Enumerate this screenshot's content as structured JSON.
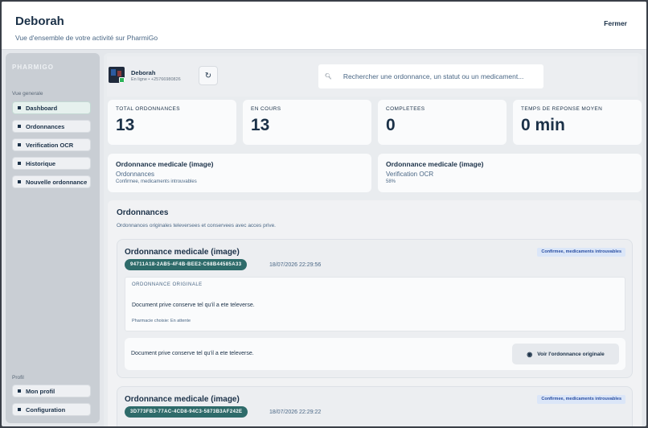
{
  "header": {
    "title": "Deborah",
    "subtitle": "Vue d'ensemble de votre activité sur PharmiGo",
    "close_label": "Fermer"
  },
  "sidebar": {
    "brand": "PHARMIGO",
    "section_overview": "Vue generale",
    "items": [
      {
        "label": "Dashboard",
        "active": true
      },
      {
        "label": "Ordonnances"
      },
      {
        "label": "Verification OCR"
      },
      {
        "label": "Historique"
      },
      {
        "label": "Nouvelle ordonnance"
      }
    ],
    "section_profile": "Profil",
    "profile_items": [
      {
        "label": "Mon profil"
      },
      {
        "label": "Configuration"
      }
    ]
  },
  "user": {
    "name": "Deborah",
    "status": "En ligne • +25766980826"
  },
  "search": {
    "placeholder": "Rechercher une ordonnance, un statut ou un medicament..."
  },
  "stats": [
    {
      "label": "TOTAL ORDONNANCES",
      "value": "13"
    },
    {
      "label": "EN COURS",
      "value": "13"
    },
    {
      "label": "COMPLETEES",
      "value": "0"
    },
    {
      "label": "TEMPS DE REPONSE MOYEN",
      "value": "0 min"
    }
  ],
  "info_cards": [
    {
      "title": "Ordonnance medicale (image)",
      "subtitle": "Ordonnances",
      "detail": "Confirmee, medicaments introuvables"
    },
    {
      "title": "Ordonnance medicale (image)",
      "subtitle": "Verification OCR",
      "detail": "58%"
    }
  ],
  "list": {
    "title": "Ordonnances",
    "subtitle": "Ordonnances originales televersees et conservees avec acces prive.",
    "items": [
      {
        "title": "Ordonnance medicale (image)",
        "badge": "Confirmee, medicaments introuvables",
        "id": "94711A18-2AB5-4F4B-BEE2-C68B44585A33",
        "date": "18/07/2026 22:29:56",
        "original_label": "ORDONNANCE ORIGINALE",
        "original_text": "Document prive conserve tel qu'il a ete televerse.",
        "pharmacy": "Pharmacie choisie: En attente",
        "footer_text": "Document prive conserve tel qu'il a ete televerse.",
        "button": "Voir l'ordonnance originale"
      },
      {
        "title": "Ordonnance medicale (image)",
        "badge": "Confirmee, medicaments introuvables",
        "id": "3D773FB3-77AC-4CD8-94C3-5873B3AF242E",
        "date": "18/07/2026 22:29:22"
      }
    ]
  },
  "icons": {
    "refresh": "refresh-icon",
    "search": "search-icon",
    "eye": "eye-icon",
    "nav_bullet": "square-bullet-icon"
  },
  "colors": {
    "id_chip": "#2e6b6a",
    "badge_bg": "#dbe6f8",
    "primary_text": "#1b3148",
    "online": "#2db35a"
  }
}
